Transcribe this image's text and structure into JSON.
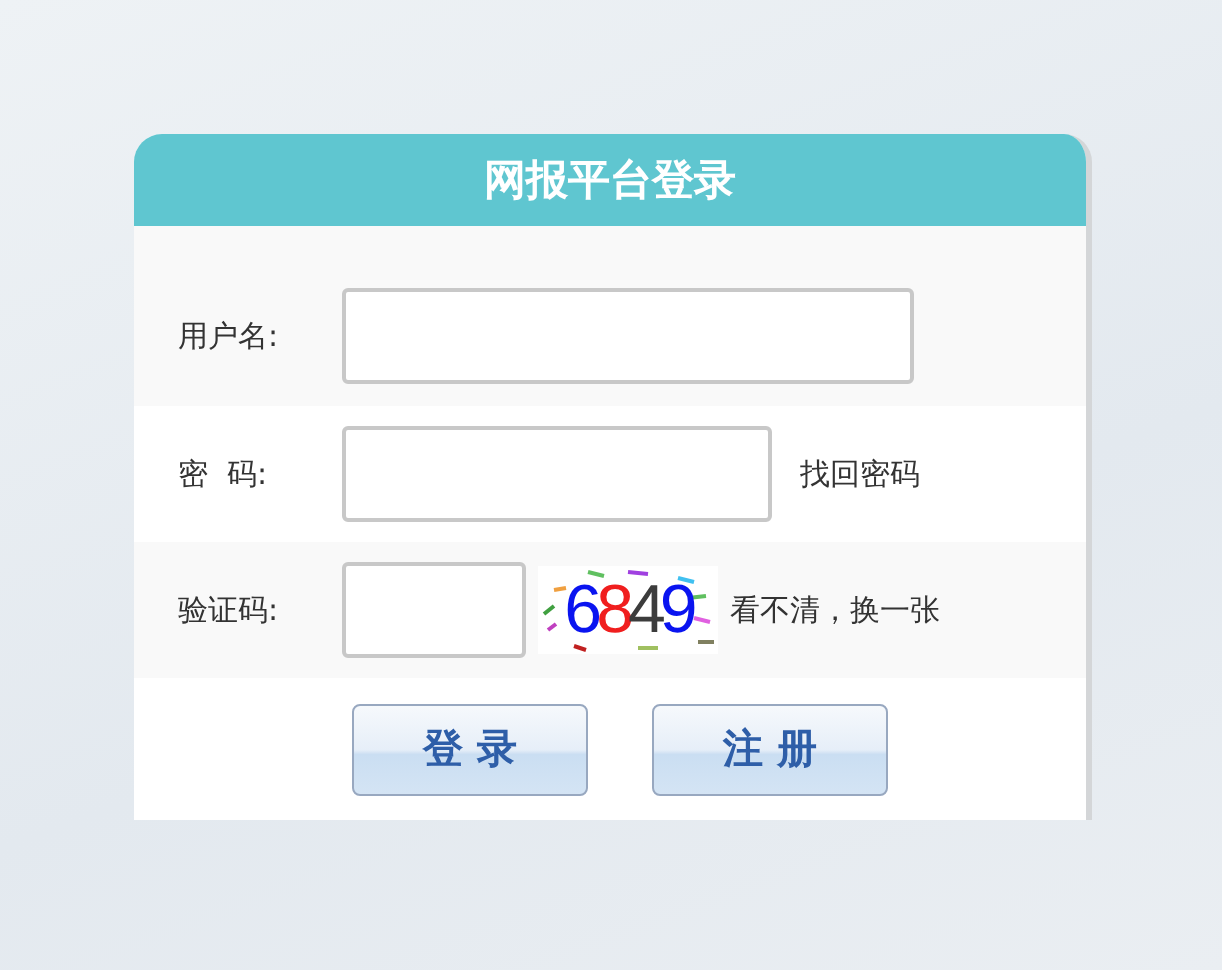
{
  "title": "网报平台登录",
  "fields": [
    {
      "kind": "text",
      "label": "用户名:"
    },
    {
      "kind": "password",
      "label": "密  码:",
      "link": "找回密码"
    },
    {
      "kind": "captcha",
      "label": "验证码:",
      "link": "看不清，换一张",
      "captcha": [
        {
          "text": "6",
          "color": "#0a14f0"
        },
        {
          "text": "8",
          "color": "#f01e1e"
        },
        {
          "text": "4",
          "color": "#3c3c3c"
        },
        {
          "text": "9",
          "color": "#0a14f0"
        }
      ]
    }
  ],
  "buttons": [
    "登 录",
    "注 册"
  ]
}
